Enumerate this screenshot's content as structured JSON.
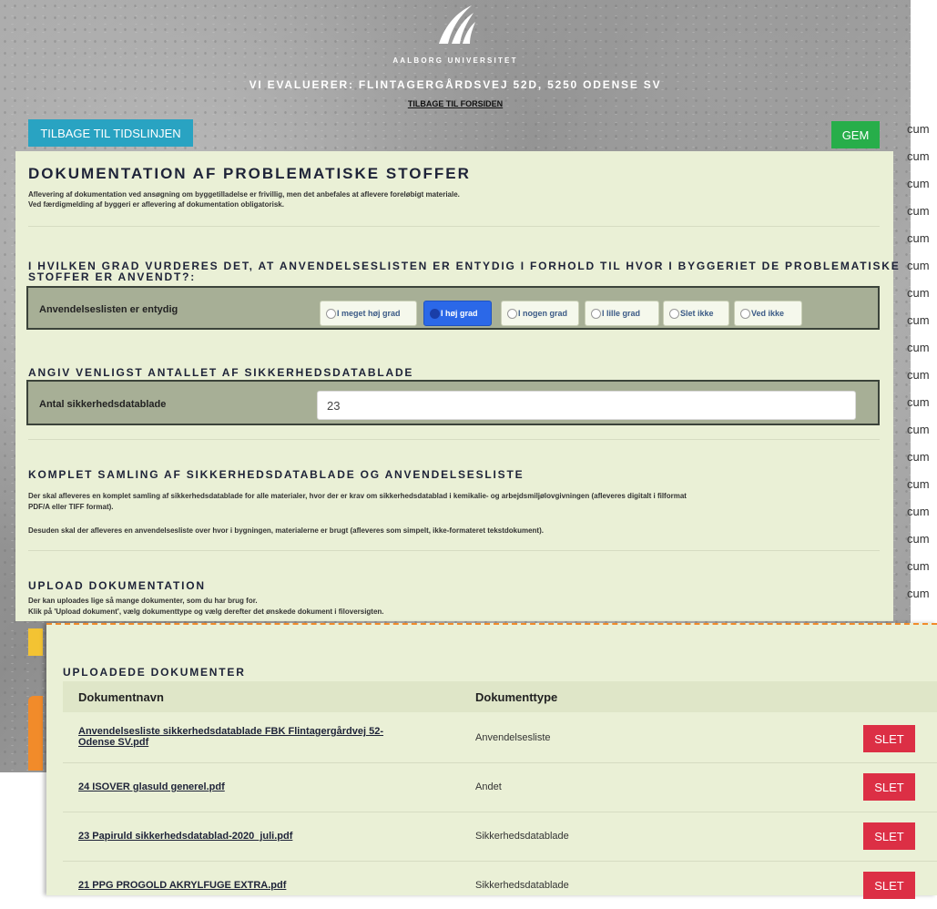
{
  "header": {
    "university": "AALBORG UNIVERSITET",
    "evaluating": "VI EVALUERER: FLINTAGERGÅRDSVEJ 52D, 5250 ODENSE SV",
    "back_to_front": "TILBAGE TIL FORSIDEN"
  },
  "toolbar": {
    "timeline_label": "TILBAGE TIL TIDSLINJEN",
    "save_label": "GEM"
  },
  "side_text": [
    "cum",
    "cum",
    "cum",
    "cum",
    "cum",
    "cum",
    "cum",
    "cum",
    "cum",
    "cum",
    "cum",
    "cum",
    "cum",
    "cum",
    "cum",
    "cum",
    "cum",
    "cum"
  ],
  "doc": {
    "title": "DOKUMENTATION AF PROBLEMATISKE STOFFER",
    "intro_1": "Aflevering af dokumentation ved ansøgning om byggetilladelse er frivillig, men det anbefales at aflevere foreløbigt materiale.",
    "intro_2": "Ved færdigmelding af byggeri er aflevering af dokumentation obligatorisk."
  },
  "question": {
    "title_1": "I HVILKEN GRAD VURDERES DET, AT ANVENDELSESLISTEN ER ENTYDIG I FORHOLD TIL HVOR I BYGGERIET DE PROBLEMATISKE",
    "title_2": "STOFFER ER ANVENDT?:",
    "label": "Anvendelseslisten er entydig",
    "options": [
      "I meget høj grad",
      "I høj grad",
      "I nogen grad",
      "I lille grad",
      "Slet ikke",
      "Ved ikke"
    ],
    "selected": "I høj grad"
  },
  "count": {
    "title": "ANGIV VENLIGST ANTALLET AF SIKKERHEDSDATABLADE",
    "label": "Antal sikkerhedsdatablade",
    "value": "23"
  },
  "collection": {
    "title": "KOMPLET SAMLING AF SIKKERHEDSDATABLADE OG ANVENDELSESLISTE",
    "text_1a": "Der skal afleveres en komplet samling af sikkerhedsdatablade for alle materialer, hvor der er krav om sikkerhedsdatablad i kemikalie- og arbejdsmiljølovgivningen (afleveres digitalt i filformat",
    "text_1b": "PDF/A eller TIFF format).",
    "text_2": "Desuden skal der afleveres en anvendelsesliste over hvor i bygningen, materialerne er brugt (afleveres som simpelt, ikke-formateret tekstdokument)."
  },
  "upload": {
    "title": "UPLOAD DOKUMENTATION",
    "text_1": "Der kan uploades lige så mange dokumenter, som du har brug for.",
    "text_2": "Klik på 'Upload dokument', vælg dokumenttype og vælg derefter det ønskede dokument i filoversigten."
  },
  "uploaded": {
    "title": "UPLOADEDE DOKUMENTER",
    "col_name": "Dokumentnavn",
    "col_type": "Dokumenttype",
    "delete_label": "SLET",
    "rows": [
      {
        "name_1": "Anvendelsesliste sikkerhedsdatablade FBK Flintagergårdvej 52-",
        "name_2": "Odense SV.pdf",
        "type": "Anvendelsesliste"
      },
      {
        "name_1": "24 ISOVER glasuld generel.pdf",
        "name_2": "",
        "type": "Andet"
      },
      {
        "name_1": "23 Papiruld sikkerhedsdatablad-2020_juli.pdf",
        "name_2": "",
        "type": "Sikkerhedsdatablade"
      },
      {
        "name_1": "21 PPG PROGOLD AKRYLFUGE EXTRA.pdf",
        "name_2": "",
        "type": "Sikkerhedsdatablade"
      }
    ]
  },
  "colors": {
    "accent_blue": "#29a3c2",
    "save_green": "#27ae4a",
    "delete_red": "#dc2f45",
    "panel_bg": "#eaf0d6",
    "selected_option": "#2b68e8",
    "upload_border": "#f18b2a"
  }
}
